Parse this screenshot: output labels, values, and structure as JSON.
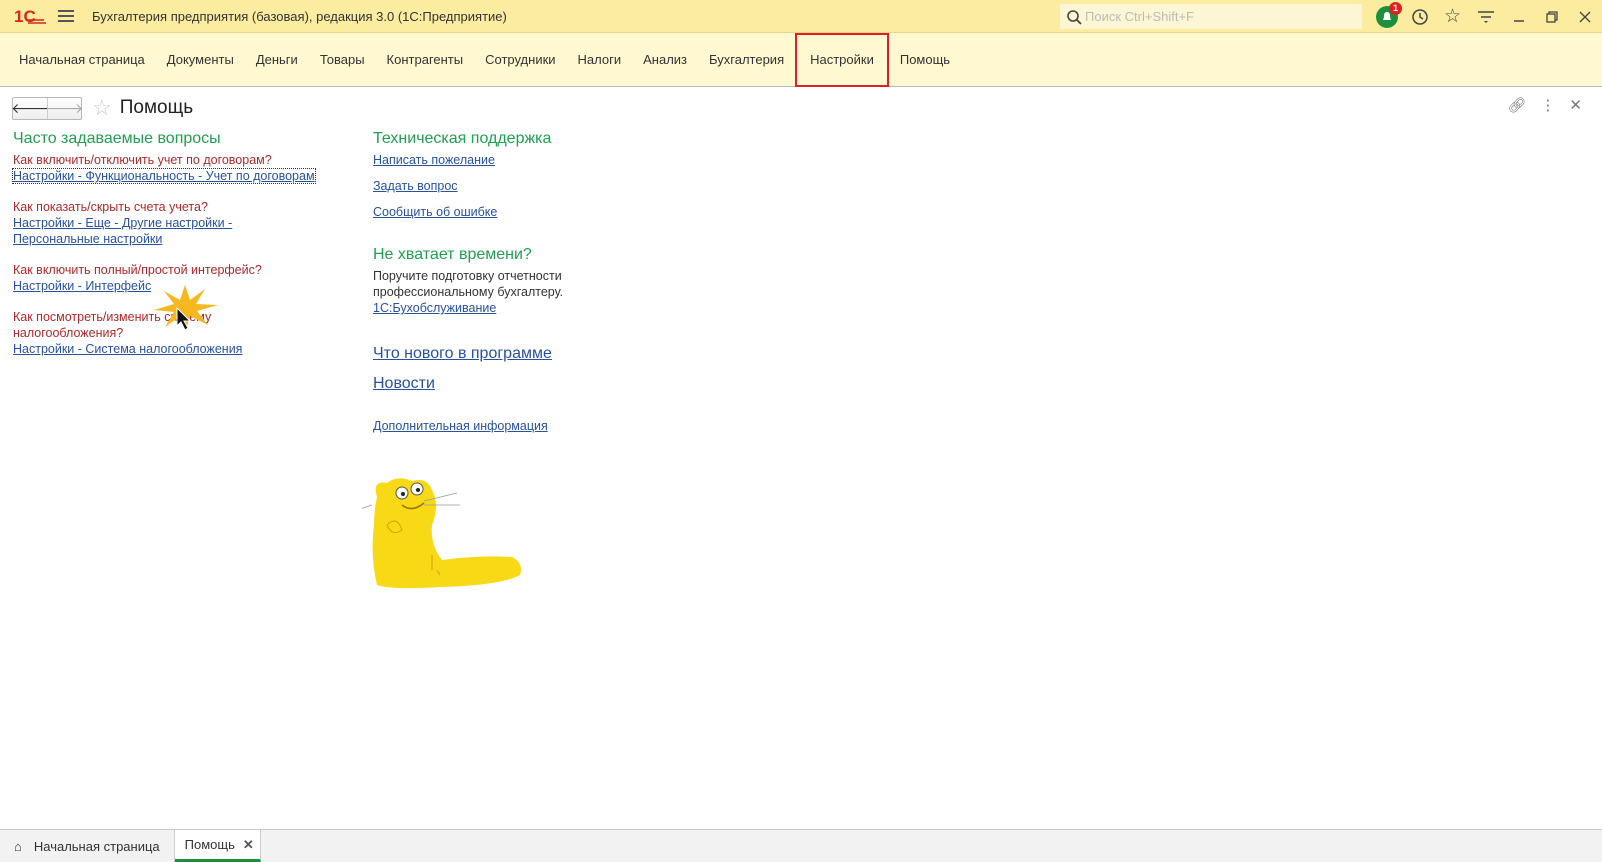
{
  "titlebar": {
    "app_title": "Бухгалтерия предприятия (базовая), редакция 3.0  (1С:Предприятие)",
    "search_placeholder": "Поиск Ctrl+Shift+F",
    "notification_count": "1"
  },
  "menu": [
    "Начальная страница",
    "Документы",
    "Деньги",
    "Товары",
    "Контрагенты",
    "Сотрудники",
    "Налоги",
    "Анализ",
    "Бухгалтерия",
    "Настройки",
    "Помощь"
  ],
  "form": {
    "title": "Помощь"
  },
  "faq": {
    "heading": "Часто задаваемые вопросы",
    "items": [
      {
        "q": "Как включить/отключить учет по договорам?",
        "links": [
          "Настройки - Функциональность - Учет по договорам"
        ]
      },
      {
        "q": "Как показать/скрыть счета учета?",
        "links": [
          "Настройки - Еще - Другие настройки -",
          "Персональные настройки"
        ]
      },
      {
        "q": "Как включить полный/простой интерфейс?",
        "links": [
          "Настройки - Интерфейс"
        ]
      },
      {
        "q": "Как посмотреть/изменить систему налогообложения?",
        "links": [
          "Настройки - Система налогообложения"
        ]
      }
    ]
  },
  "support": {
    "heading": "Техническая поддержка",
    "links": [
      "Написать пожелание",
      "Задать вопрос",
      "Сообщить об ошибке"
    ]
  },
  "time": {
    "heading": "Не хватает времени?",
    "text": "Поручите подготовку отчетности профессиональному бухгалтеру.",
    "link": "1С:Бухобслуживание"
  },
  "whats_new": "Что нового в программе",
  "news": "Новости",
  "more_info": "Дополнительная информация",
  "tabs": [
    "Начальная страница",
    "Помощь"
  ],
  "colors": {
    "accent_green": "#1e8f3c",
    "heading": "#20a050",
    "question": "#b02828",
    "link": "#2851a0",
    "titlebar": "#fbeca0",
    "menubar": "#fff8d0"
  }
}
